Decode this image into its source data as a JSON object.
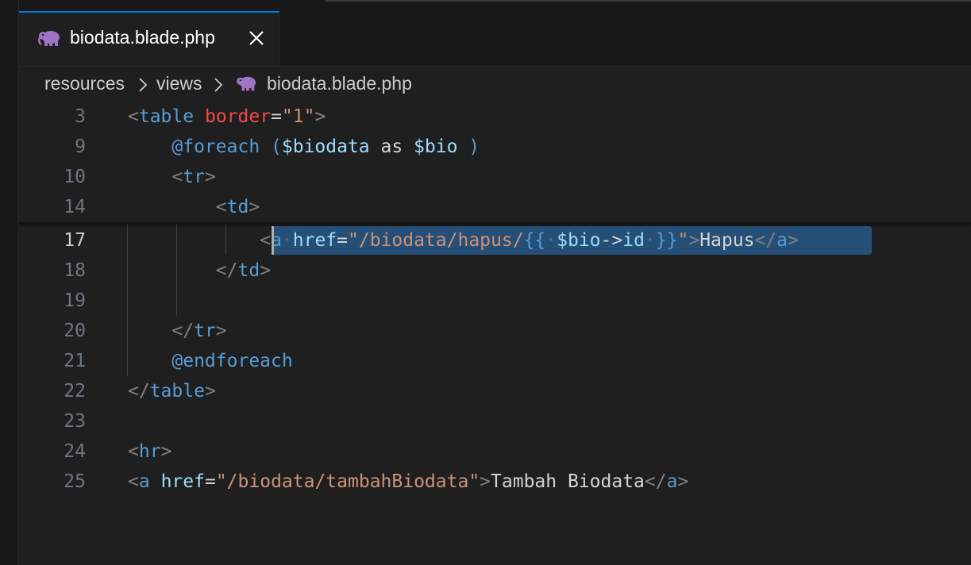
{
  "tab": {
    "label": "biodata.blade.php",
    "icon": "php-elephant-icon",
    "close": "close-icon",
    "accent": "#0078d4"
  },
  "breadcrumb": {
    "items": [
      "resources",
      "views",
      "biodata.blade.php"
    ]
  },
  "lines": [
    {
      "num": "3"
    },
    {
      "num": "9"
    },
    {
      "num": "10"
    },
    {
      "num": "14"
    },
    {
      "num": "17"
    },
    {
      "num": "18"
    },
    {
      "num": "19"
    },
    {
      "num": "20"
    },
    {
      "num": "21"
    },
    {
      "num": "22"
    },
    {
      "num": "23"
    },
    {
      "num": "24"
    },
    {
      "num": "25"
    }
  ],
  "code": {
    "l3": {
      "tag": "table",
      "attr": "border",
      "value": "\"1\""
    },
    "l9": {
      "kw": "@foreach",
      "open": " (",
      "var1": "$biodata",
      "as": " as ",
      "var2": "$bio",
      "close": " )"
    },
    "l10": {
      "tag": "tr"
    },
    "l14": {
      "tag": "td"
    },
    "l17": {
      "tag": "a",
      "attr": "href",
      "str1": "\"/biodata/hapus/",
      "blade_open": "{{",
      "var": "$bio",
      "arrow": "->",
      "prop": "id",
      "blade_close": "}}",
      "str2": "\"",
      "text": "Hapus",
      "close_tag": "a"
    },
    "l18": {
      "tag": "td"
    },
    "l20": {
      "tag": "tr"
    },
    "l21": {
      "kw": "@endforeach"
    },
    "l22": {
      "tag": "table"
    },
    "l24": {
      "tag": "hr"
    },
    "l25": {
      "tag": "a",
      "attr": "href",
      "value": "\"/biodata/tambahBiodata\"",
      "text": "Tambah Biodata",
      "close_tag": "a"
    }
  },
  "active_line": "17",
  "selection_color": "#264f78"
}
